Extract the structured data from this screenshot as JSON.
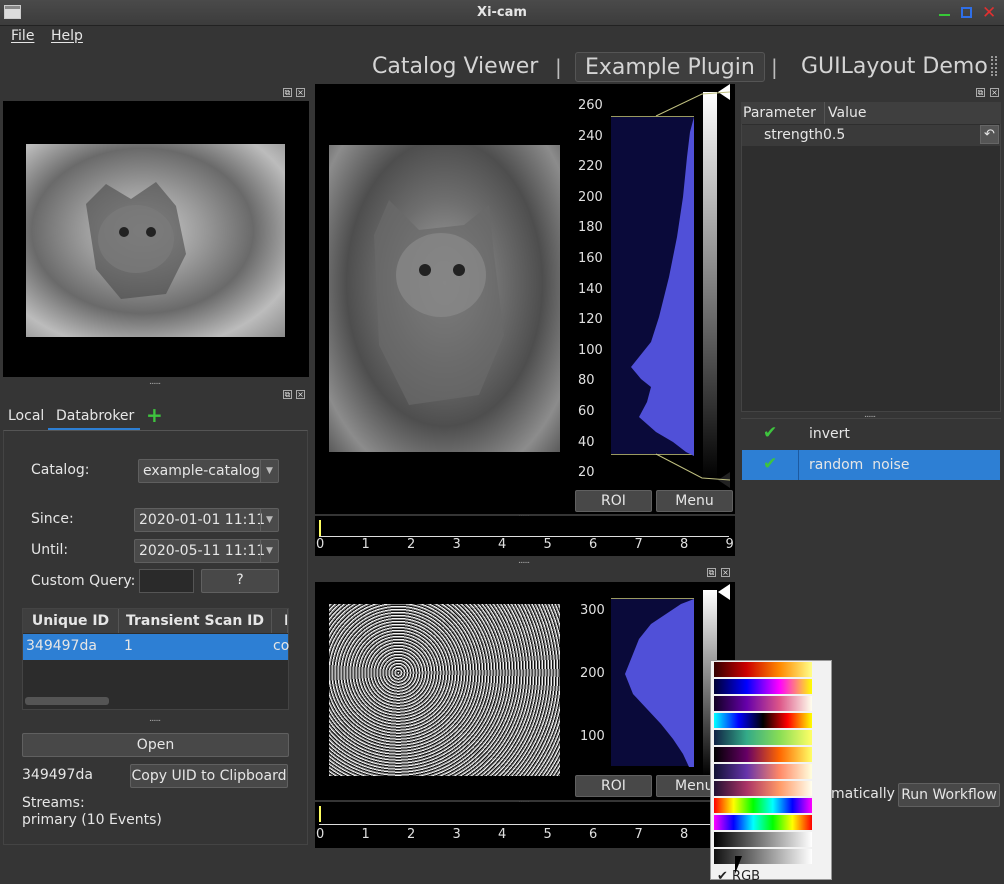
{
  "window": {
    "title": "Xi-cam"
  },
  "menu": {
    "file": "File",
    "help": "Help"
  },
  "perspectives": [
    "Catalog Viewer",
    "|",
    "Example Plugin",
    "|",
    "GUILayout Demo"
  ],
  "params": {
    "col_param": "Parameter",
    "col_value": "Value",
    "row_name": "strength",
    "row_value": "0.5"
  },
  "workflow": {
    "items": [
      "invert",
      "random  noise"
    ],
    "auto_text": "matically",
    "run_label": "Run Workflow"
  },
  "browser": {
    "tabs": [
      "Local",
      "Databroker"
    ],
    "add": "+",
    "catalog_label": "Catalog:",
    "catalog_value": "example-catalog",
    "since_label": "Since:",
    "since_value": "2020-01-01 11:11",
    "until_label": "Until:",
    "until_value": "2020-05-11 11:11",
    "query_label": "Custom Query:",
    "query_btn": "?",
    "table_headers": [
      "Unique ID",
      "Transient Scan ID",
      "I"
    ],
    "table_rows": [
      [
        "349497da",
        "1",
        "co"
      ]
    ],
    "open_label": "Open",
    "uid": "349497da",
    "copy_label": "Copy UID to Clipboard",
    "streams_label": "Streams:",
    "streams_value": "primary (10 Events)"
  },
  "viewer_top": {
    "y_ticks": [
      "260",
      "240",
      "220",
      "200",
      "180",
      "160",
      "140",
      "120",
      "100",
      "80",
      "60",
      "40",
      "20"
    ],
    "roi": "ROI",
    "menu": "Menu",
    "x_ticks": [
      "0",
      "1",
      "2",
      "3",
      "4",
      "5",
      "6",
      "7",
      "8",
      "9"
    ]
  },
  "viewer_bottom": {
    "y_ticks": [
      "300",
      "200",
      "100"
    ],
    "roi": "ROI",
    "menu": "Menu",
    "x_ticks": [
      "0",
      "1",
      "2",
      "3",
      "4",
      "5",
      "6",
      "7",
      "8"
    ]
  },
  "colormap_menu": {
    "last_label": "RGB"
  },
  "colors": {
    "accent": "#2d7fd4",
    "histogram": "#5050d8",
    "check": "#3ec43e"
  }
}
